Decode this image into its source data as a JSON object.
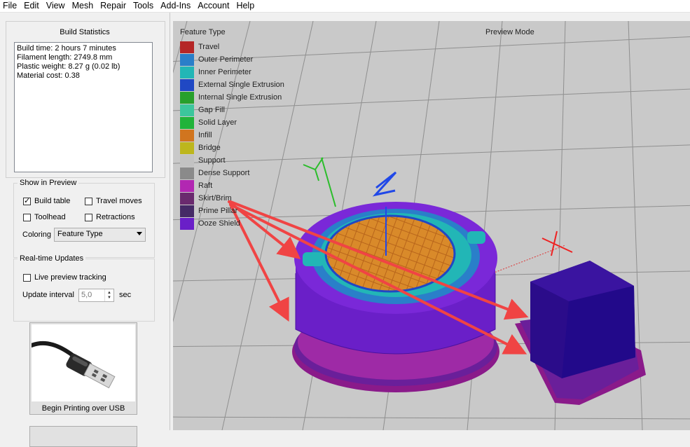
{
  "menu": [
    "File",
    "Edit",
    "View",
    "Mesh",
    "Repair",
    "Tools",
    "Add-Ins",
    "Account",
    "Help"
  ],
  "build_stats": {
    "title": "Build Statistics",
    "lines": [
      "Build time: 2 hours 7 minutes",
      "Filament length: 2749.8 mm",
      "Plastic weight: 8.27 g (0.02 lb)",
      "Material cost: 0.38"
    ]
  },
  "show_in_preview": {
    "title": "Show in Preview",
    "build_table": "Build table",
    "travel_moves": "Travel moves",
    "toolhead": "Toolhead",
    "retractions": "Retractions",
    "coloring_label": "Coloring",
    "coloring_value": "Feature Type"
  },
  "realtime": {
    "title": "Real-time Updates",
    "live_preview": "Live preview tracking",
    "interval_label": "Update interval",
    "interval_value": "5,0",
    "interval_unit": "sec"
  },
  "usb_button": "Begin Printing over USB",
  "viewport": {
    "legend_title": "Feature Type",
    "preview_mode": "Preview Mode",
    "legend": [
      {
        "label": "Travel",
        "color": "#b52727"
      },
      {
        "label": "Outer Perimeter",
        "color": "#2a7fc9"
      },
      {
        "label": "Inner Perimeter",
        "color": "#22b6b6"
      },
      {
        "label": "External Single Extrusion",
        "color": "#2048c4"
      },
      {
        "label": "Internal Single Extrusion",
        "color": "#27a02c"
      },
      {
        "label": "Gap Fill",
        "color": "#3cc69c"
      },
      {
        "label": "Solid Layer",
        "color": "#21b33a"
      },
      {
        "label": "Infill",
        "color": "#d1751f"
      },
      {
        "label": "Bridge",
        "color": "#bdb61d"
      },
      {
        "label": "Support",
        "color": "#c2c2c2"
      },
      {
        "label": "Dense Support",
        "color": "#8a8a8a"
      },
      {
        "label": "Raft",
        "color": "#b227b2"
      },
      {
        "label": "Skirt/Brim",
        "color": "#6a2a6e"
      },
      {
        "label": "Prime Pillar",
        "color": "#452a66"
      },
      {
        "label": "Ooze Shield",
        "color": "#6a1fc8"
      }
    ],
    "axis_y": "Y",
    "axis_z": "Z"
  }
}
